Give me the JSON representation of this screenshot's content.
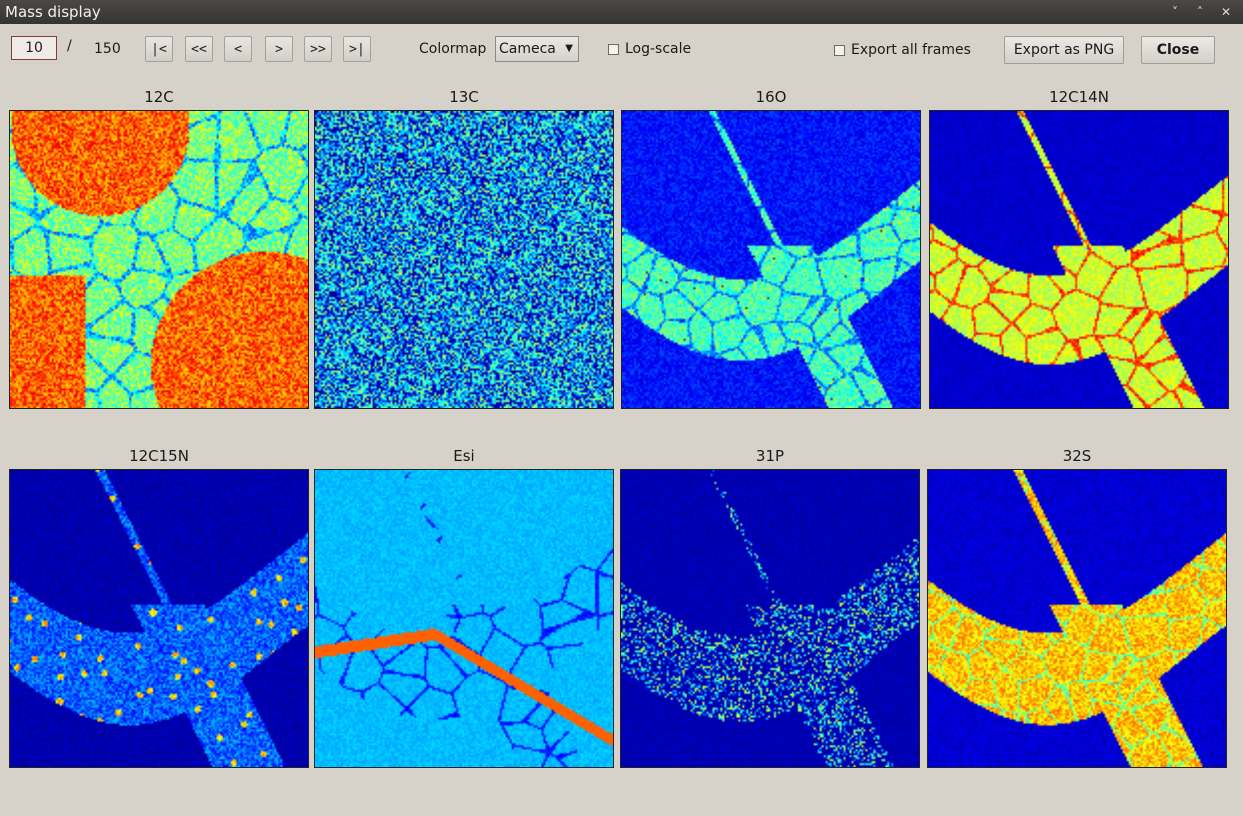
{
  "window": {
    "title": "Mass display",
    "controls": [
      "˅",
      "˄",
      "✕"
    ]
  },
  "toolbar": {
    "frame_value": "10",
    "slash": "/",
    "total_frames": "150",
    "nav": [
      "|<",
      "<<",
      "<",
      ">",
      ">>",
      ">|"
    ],
    "colormap_label": "Colormap",
    "colormap_value": "Cameca",
    "log_scale_label": "Log-scale",
    "export_all_label": "Export all frames",
    "export_png_label": "Export as PNG",
    "close_label": "Close"
  },
  "panels": [
    {
      "name": "12C",
      "style": "c12"
    },
    {
      "name": "13C",
      "style": "noise"
    },
    {
      "name": "16O",
      "style": "o16"
    },
    {
      "name": "12C14N",
      "style": "cn14"
    },
    {
      "name": "12C15N",
      "style": "cn15"
    },
    {
      "name": "Esi",
      "style": "esi"
    },
    {
      "name": "31P",
      "style": "p31"
    },
    {
      "name": "32S",
      "style": "s32"
    }
  ]
}
